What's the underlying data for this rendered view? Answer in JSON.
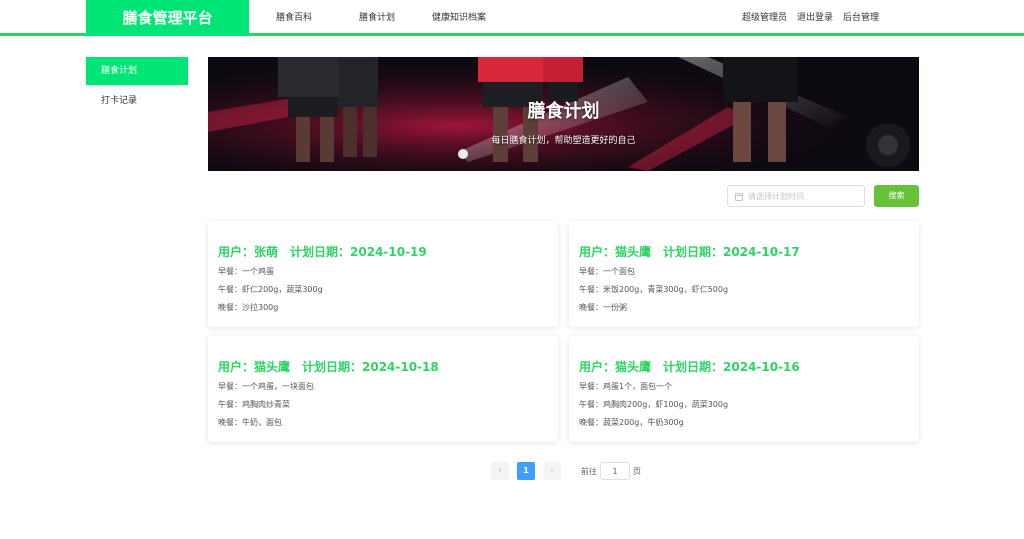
{
  "header": {
    "logo": "膳食管理平台",
    "nav": [
      "膳食百科",
      "膳食计划",
      "健康知识档案"
    ],
    "right_links": [
      "超级管理员",
      "退出登录",
      "后台管理"
    ]
  },
  "sidebar": {
    "items": [
      {
        "label": "膳食计划",
        "active": true
      },
      {
        "label": "打卡记录",
        "active": false
      }
    ]
  },
  "banner": {
    "title": "膳食计划",
    "subtitle": "每日膳食计划，帮助塑造更好的自己"
  },
  "search": {
    "placeholder": "请选择计划时间",
    "value": "",
    "button": "搜索"
  },
  "cards": [
    {
      "title": "用户：张萌　计划日期：2024-10-19",
      "breakfast": "早餐：一个鸡蛋",
      "lunch": "午餐：虾仁200g，蔬菜300g",
      "dinner": "晚餐：沙拉300g"
    },
    {
      "title": "用户：猫头鹰　计划日期：2024-10-17",
      "breakfast": "早餐：一个面包",
      "lunch": "午餐：米饭200g，青菜300g，虾仁500g",
      "dinner": "晚餐：一份粥"
    },
    {
      "title": "用户：猫头鹰　计划日期：2024-10-18",
      "breakfast": "早餐：一个鸡蛋，一块面包",
      "lunch": "午餐：鸡胸肉炒青菜",
      "dinner": "晚餐：牛奶，面包"
    },
    {
      "title": "用户：猫头鹰　计划日期：2024-10-16",
      "breakfast": "早餐：鸡蛋1个，面包一个",
      "lunch": "午餐：鸡胸肉200g，虾100g，蔬菜300g",
      "dinner": "晚餐：蔬菜200g，牛奶300g"
    }
  ],
  "pagination": {
    "prev": "‹",
    "current": "1",
    "next": "›",
    "goto_prefix": "前往",
    "goto_value": "1",
    "goto_suffix": "页"
  },
  "colors": {
    "brand_green": "#00e676",
    "title_green": "#2ed463",
    "search_button": "#67c23a",
    "page_active": "#409eff"
  }
}
